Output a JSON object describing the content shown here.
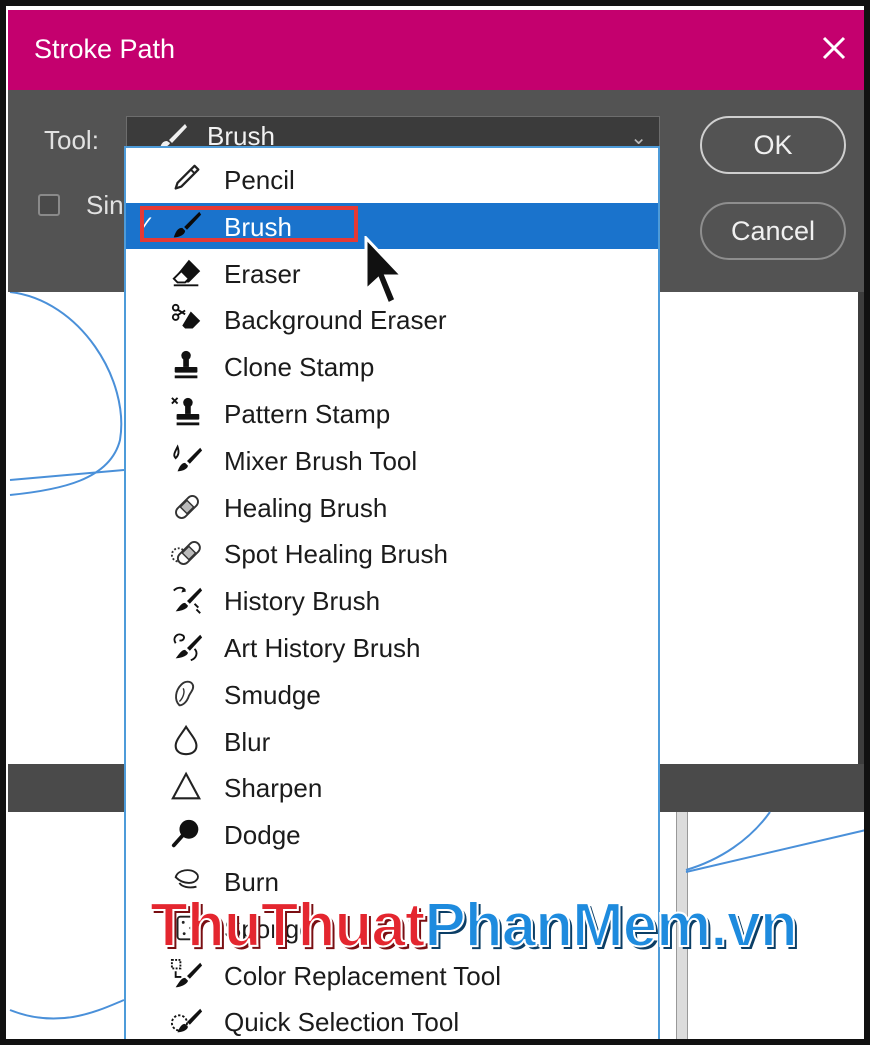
{
  "dialog": {
    "title": "Stroke Path",
    "close_icon": "close-icon",
    "tool_label": "Tool:",
    "selected_tool": "Brush",
    "simulate_label": "Sin",
    "ok_label": "OK",
    "cancel_label": "Cancel",
    "colors": {
      "titlebar": "#c4006e",
      "body": "#535353",
      "selection": "#1a73cc",
      "highlight": "#e53935"
    }
  },
  "dropdown": {
    "items": [
      {
        "label": "Pencil",
        "icon": "pencil-icon"
      },
      {
        "label": "Brush",
        "icon": "brush-icon",
        "selected": true
      },
      {
        "label": "Eraser",
        "icon": "eraser-icon"
      },
      {
        "label": "Background Eraser",
        "icon": "background-eraser-icon"
      },
      {
        "label": "Clone Stamp",
        "icon": "clone-stamp-icon"
      },
      {
        "label": "Pattern Stamp",
        "icon": "pattern-stamp-icon"
      },
      {
        "label": "Mixer Brush Tool",
        "icon": "mixer-brush-icon"
      },
      {
        "label": "Healing Brush",
        "icon": "healing-brush-icon"
      },
      {
        "label": "Spot Healing Brush",
        "icon": "spot-healing-brush-icon"
      },
      {
        "label": "History Brush",
        "icon": "history-brush-icon"
      },
      {
        "label": "Art History Brush",
        "icon": "art-history-brush-icon"
      },
      {
        "label": "Smudge",
        "icon": "smudge-icon"
      },
      {
        "label": "Blur",
        "icon": "blur-icon"
      },
      {
        "label": "Sharpen",
        "icon": "sharpen-icon"
      },
      {
        "label": "Dodge",
        "icon": "dodge-icon"
      },
      {
        "label": "Burn",
        "icon": "burn-icon"
      },
      {
        "label": "Sponge",
        "icon": "sponge-icon"
      },
      {
        "label": "Color Replacement Tool",
        "icon": "color-replacement-icon"
      },
      {
        "label": "Quick Selection Tool",
        "icon": "quick-selection-icon"
      }
    ]
  },
  "watermark": {
    "part1": "ThuThuat",
    "part2": "PhanMem",
    "part3": ".vn"
  }
}
